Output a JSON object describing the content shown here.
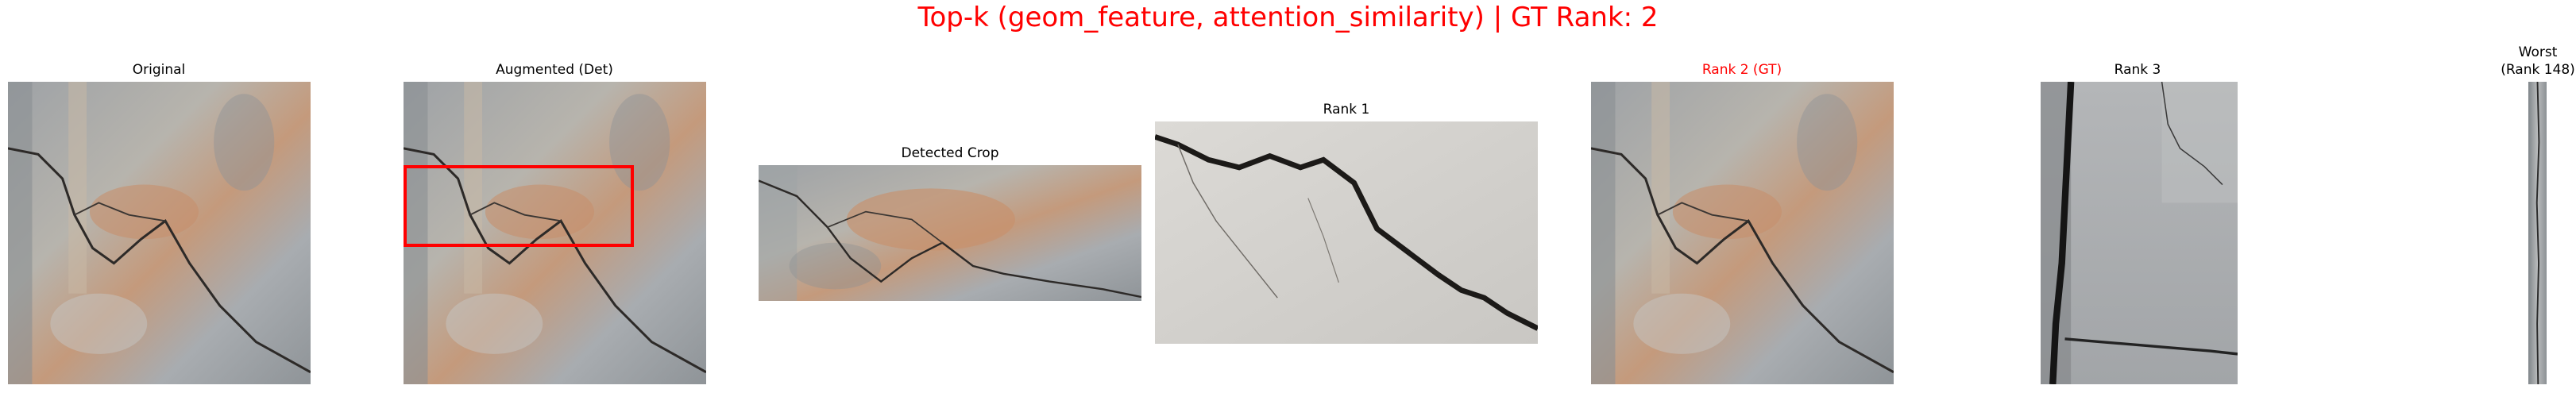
{
  "figure": {
    "title": "Top-k (geom_feature, attention_similarity) | GT Rank: 2",
    "title_color": "#ff0000"
  },
  "panels": [
    {
      "id": "original",
      "title": "Original",
      "title_color": "#000000"
    },
    {
      "id": "augmented",
      "title": "Augmented (Det)",
      "title_color": "#000000"
    },
    {
      "id": "detected_crop",
      "title": "Detected Crop",
      "title_color": "#000000"
    },
    {
      "id": "rank1",
      "title": "Rank 1",
      "title_color": "#000000"
    },
    {
      "id": "rank2",
      "title": "Rank 2 (GT)",
      "title_color": "#ff0000"
    },
    {
      "id": "rank3",
      "title": "Rank 3",
      "title_color": "#000000"
    },
    {
      "id": "worst",
      "title_line1": "Worst",
      "title_line2": "(Rank 148)",
      "title_color": "#000000"
    }
  ],
  "detection_box_color": "#ff0000"
}
